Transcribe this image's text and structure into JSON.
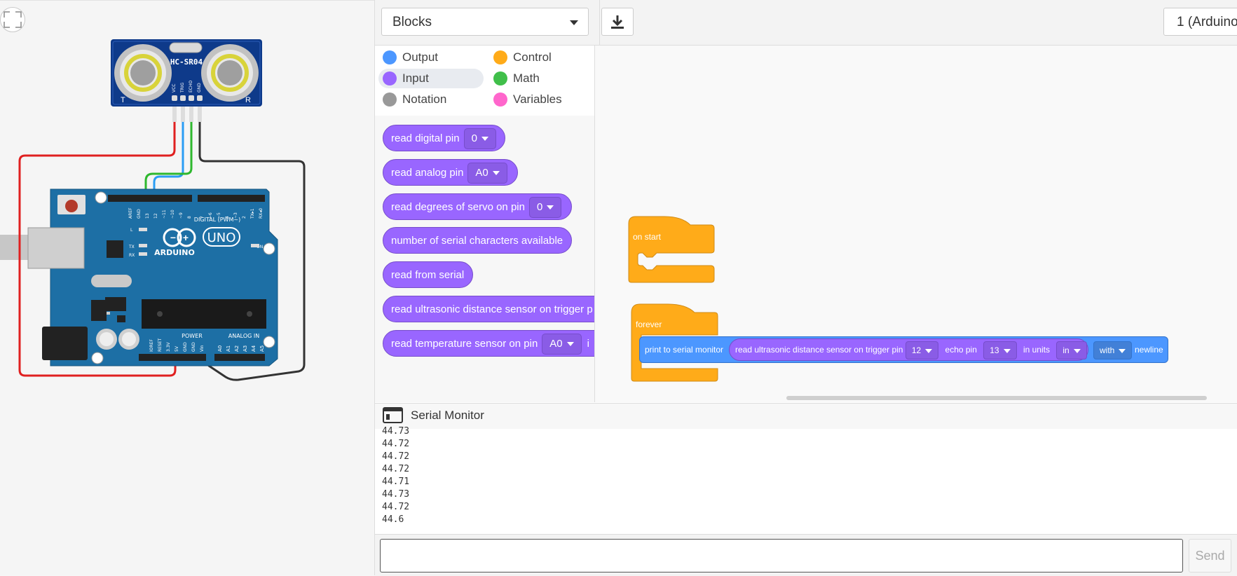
{
  "circuit": {
    "sensor_label": "HC-SR04",
    "sensor_pins": [
      "VCC",
      "TRIG",
      "ECHO",
      "GND"
    ],
    "sensor_corner_left": "T",
    "sensor_corner_right": "R",
    "board_brand": "ARDUINO",
    "board_model": "UNO",
    "digital_label": "DIGITAL (PWM~)",
    "power_label": "POWER",
    "analog_label": "ANALOG IN",
    "on_label": "ON",
    "digital_pins": [
      "AREF",
      "GND",
      "13",
      "12",
      "~11",
      "~10",
      "~9",
      "8",
      "7",
      "~6",
      "~5",
      "4",
      "~3",
      "2",
      "TX▸1",
      "RX◂0"
    ],
    "power_pins": [
      "IOREF",
      "RESET",
      "3.3V",
      "5V",
      "GND",
      "GND",
      "Vin"
    ],
    "analog_pins": [
      "A0",
      "A1",
      "A2",
      "A3",
      "A4",
      "A5"
    ],
    "led_labels": [
      "L",
      "TX",
      "RX"
    ]
  },
  "toolbar": {
    "mode": "Blocks",
    "device": "1 (Arduino"
  },
  "categories": [
    {
      "label": "Output",
      "color": "#4c97ff"
    },
    {
      "label": "Control",
      "color": "#ffab19"
    },
    {
      "label": "Input",
      "color": "#9966ff"
    },
    {
      "label": "Math",
      "color": "#40bf4a"
    },
    {
      "label": "Notation",
      "color": "#999999"
    },
    {
      "label": "Variables",
      "color": "#ff66cc"
    }
  ],
  "palette": [
    {
      "label": "read digital pin",
      "value": "0"
    },
    {
      "label": "read analog pin",
      "value": "A0"
    },
    {
      "label": "read degrees of servo on pin",
      "value": "0"
    },
    {
      "label": "number of serial characters available"
    },
    {
      "label": "read from serial"
    },
    {
      "label": "read ultrasonic distance sensor on trigger p"
    },
    {
      "label": "read temperature sensor on pin",
      "value": "A0",
      "suffix": "i"
    }
  ],
  "workspace": {
    "on_start": "on start",
    "forever": "forever",
    "print_label": "print to serial monitor",
    "ultra_label": "read ultrasonic distance sensor on trigger pin",
    "trigger_pin": "12",
    "echo_label": "echo pin",
    "echo_pin": "13",
    "units_label": "in units",
    "units": "in",
    "with_value": "with",
    "newline_label": "newline"
  },
  "serial": {
    "title": "Serial Monitor",
    "lines": [
      "44.73",
      "44.72",
      "44.72",
      "44.72",
      "44.71",
      "44.73",
      "44.72",
      "44.6"
    ],
    "input_value": "",
    "send_label": "Send"
  }
}
